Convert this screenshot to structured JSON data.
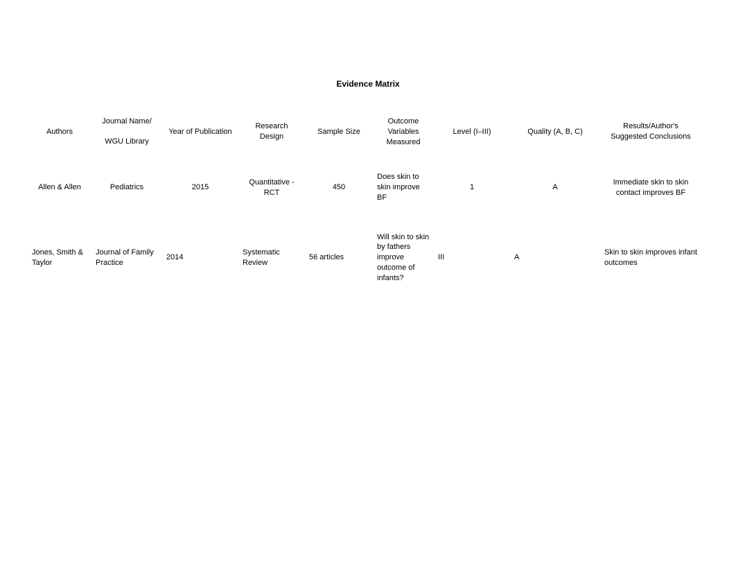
{
  "title": "Evidence Matrix",
  "headers": {
    "authors": "Authors",
    "journal_line1": "Journal Name/",
    "journal_line2": "WGU Library",
    "year": "Year of Publication",
    "design": "Research Design",
    "sample": "Sample Size",
    "outcome": "Outcome Variables Measured",
    "level": "Level (I–III)",
    "quality": "Quality (A, B, C)",
    "results": "Results/Author's Suggested Conclusions"
  },
  "rows": [
    {
      "authors": "Allen & Allen",
      "journal": "Pediatrics",
      "year": "2015",
      "design": "Quantitative - RCT",
      "sample": "450",
      "outcome": "Does skin to skin improve BF",
      "level": "1",
      "quality": "A",
      "results": "Immediate skin to skin contact improves BF"
    },
    {
      "authors": "Jones, Smith & Taylor",
      "journal": "Journal of Family Practice",
      "year": "2014",
      "design": "Systematic Review",
      "sample": "56 articles",
      "outcome": "Will skin to skin by fathers improve outcome of infants?",
      "level": "III",
      "quality": "A",
      "results": "Skin to skin improves infant outcomes"
    }
  ]
}
